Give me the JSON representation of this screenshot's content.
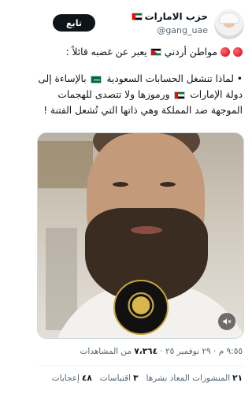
{
  "header": {
    "display_name": "حزب الامارات",
    "handle": "@gang_uae",
    "follow_label": "تابع"
  },
  "tweet": {
    "line1": "مواطن أردني",
    "line1_rest": "يعبر عن غضبه قائلاً :",
    "para_a": "• لماذا تنشغل الحسابات السعودية",
    "para_b": "بالإساءة إلى دولة الإمارات",
    "para_c": "ورموزها ولا تتصدى للهجمات الموجهة ضد المملكة وهي ذاتها التي تُشعل الفتنة !"
  },
  "meta": {
    "time": "٩:٥٥ م",
    "date": "٢٩ نوفمبر ٢٥",
    "views_count": "٧،٣٦٤",
    "views_label": "من المشاهدات"
  },
  "stats": {
    "reposts_count": "٢١",
    "reposts_label": "المنشورات المعاد نشرها",
    "quotes_count": "٣",
    "quotes_label": "اقتباسات",
    "likes_count": "٤٨",
    "likes_label": "إعجابات"
  },
  "icons": {
    "flag_uae": "uae-flag-icon",
    "flag_jordan": "jordan-flag-icon",
    "flag_saudi": "saudi-flag-icon",
    "red_circle": "red-circle-icon",
    "volume": "volume-icon"
  }
}
